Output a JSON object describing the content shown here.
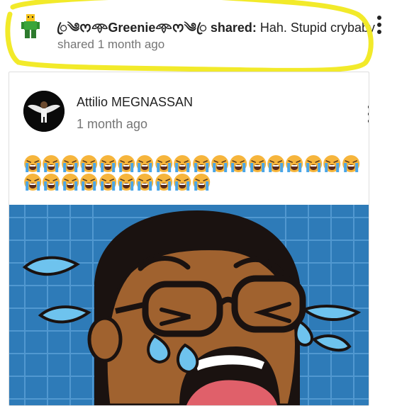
{
  "share": {
    "user_name": "ꦿ༄ᰔ𖥸Greenie𖥸ᰔ༄ꦿ",
    "shared_label": "shared:",
    "message": "Hah. Stupid crybaby",
    "time": "shared 1 month ago",
    "avatar_icon": "green-character-avatar"
  },
  "post": {
    "author": "Attilio MEGNASSAN",
    "time": "1 month ago",
    "avatar_icon": "winged-figure-avatar",
    "emoji_icon": "loudly-crying-face-emoji",
    "emoji_row1_count": 18,
    "emoji_row2_count": 10,
    "image": "crying-cartoon-boy-image"
  },
  "menu_icon": "more-vertical-icon",
  "colors": {
    "highlight": "#f2ea2a",
    "image_background": "#2e7bb8",
    "grid_lines": "#5aa0d6",
    "skin": "#a0622f",
    "tears": "#6ec3ee"
  }
}
